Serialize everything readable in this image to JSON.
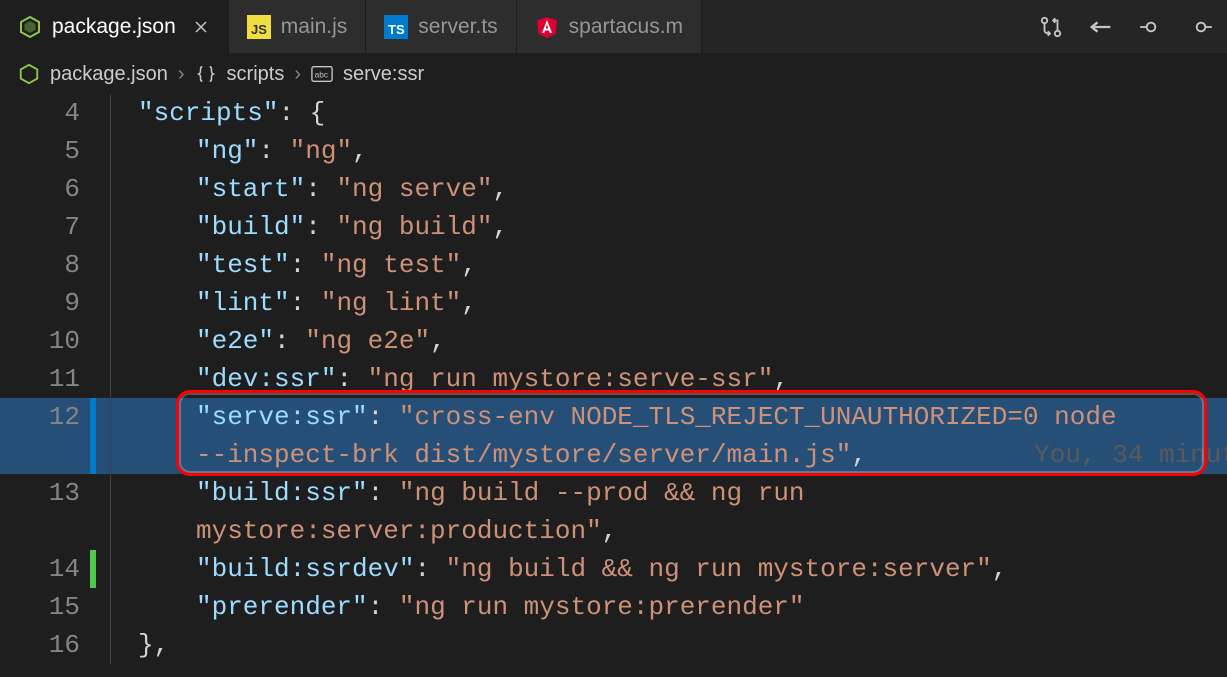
{
  "tabs": {
    "active": {
      "label": "package.json",
      "icon": "nodejs"
    },
    "items": [
      {
        "label": "main.js",
        "icon": "js"
      },
      {
        "label": "server.ts",
        "icon": "ts"
      },
      {
        "label": "spartacus.m",
        "icon": "angular"
      }
    ]
  },
  "breadcrumb": {
    "file": "package.json",
    "section": "scripts",
    "key": "serve:ssr"
  },
  "blame": {
    "text": "You, 34 minut"
  },
  "code": {
    "lines": [
      {
        "num": "4",
        "type": "obj-open",
        "key": "\"scripts\"",
        "rest": ": {"
      },
      {
        "num": "5",
        "type": "kv",
        "key": "\"ng\"",
        "val": "\"ng\"",
        "comma": true
      },
      {
        "num": "6",
        "type": "kv",
        "key": "\"start\"",
        "val": "\"ng serve\"",
        "comma": true
      },
      {
        "num": "7",
        "type": "kv",
        "key": "\"build\"",
        "val": "\"ng build\"",
        "comma": true
      },
      {
        "num": "8",
        "type": "kv",
        "key": "\"test\"",
        "val": "\"ng test\"",
        "comma": true
      },
      {
        "num": "9",
        "type": "kv",
        "key": "\"lint\"",
        "val": "\"ng lint\"",
        "comma": true
      },
      {
        "num": "10",
        "type": "kv",
        "key": "\"e2e\"",
        "val": "\"ng e2e\"",
        "comma": true
      },
      {
        "num": "11",
        "type": "kv",
        "key": "\"dev:ssr\"",
        "val": "\"ng run mystore:serve-ssr\"",
        "comma": true
      },
      {
        "num": "12",
        "type": "kv-wrap",
        "key": "\"serve:ssr\"",
        "val1": "\"cross-env NODE_TLS_REJECT_UNAUTHORIZED=0 node ",
        "val2": "--inspect-brk dist/mystore/server/main.js\"",
        "comma": true,
        "highlighted": true,
        "bar": "blue"
      },
      {
        "num": "13",
        "type": "kv-wrap2",
        "key": "\"build:ssr\"",
        "val1": "\"ng build --prod && ng run ",
        "val2": "mystore:server:production\"",
        "comma": true
      },
      {
        "num": "14",
        "type": "kv",
        "key": "\"build:ssrdev\"",
        "val": "\"ng build && ng run mystore:server\"",
        "comma": true,
        "bar": "green"
      },
      {
        "num": "15",
        "type": "kv",
        "key": "\"prerender\"",
        "val": "\"ng run mystore:prerender\"",
        "comma": false
      },
      {
        "num": "16",
        "type": "obj-close",
        "text": "},"
      }
    ]
  }
}
